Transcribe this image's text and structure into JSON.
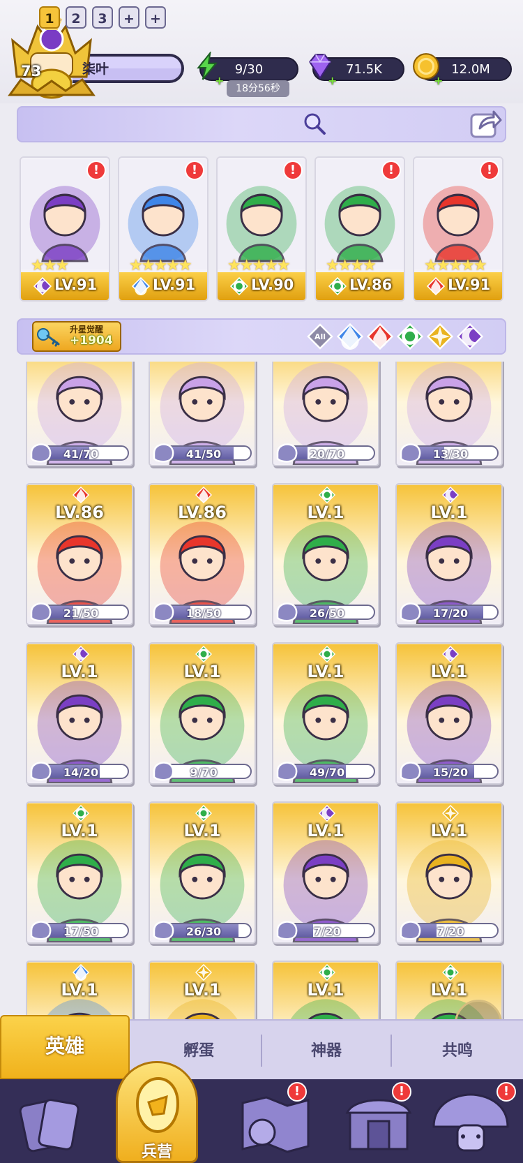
{
  "player": {
    "level": "73",
    "name": "柒叶"
  },
  "resources": {
    "energy": {
      "value": "9/30",
      "timer": "18分56秒",
      "icon": "lightning-icon"
    },
    "gems": {
      "value": "71.5K",
      "icon": "gem-icon"
    },
    "gold": {
      "value": "12.0M",
      "icon": "coin-icon"
    }
  },
  "team_tabs": [
    "1",
    "2",
    "3",
    "+",
    "+"
  ],
  "lineup": [
    {
      "level": "LV.91",
      "element": "dark",
      "stars": 3,
      "alert": "!"
    },
    {
      "level": "LV.91",
      "element": "water",
      "stars": 5,
      "alert": "!"
    },
    {
      "level": "LV.90",
      "element": "wind",
      "stars": 5,
      "alert": "!"
    },
    {
      "level": "LV.86",
      "element": "wind",
      "stars": 4,
      "alert": "!"
    },
    {
      "level": "LV.91",
      "element": "fire",
      "stars": 5,
      "alert": "!"
    }
  ],
  "awaken": {
    "label": "升星觉醒",
    "count": "+1904"
  },
  "filters": [
    {
      "label": "All",
      "icon": "all-filter-icon"
    },
    {
      "label": "",
      "icon": "water-element-icon"
    },
    {
      "label": "",
      "icon": "fire-element-icon"
    },
    {
      "label": "",
      "icon": "wind-element-icon"
    },
    {
      "label": "",
      "icon": "light-element-icon"
    },
    {
      "label": "",
      "icon": "dark-element-icon"
    }
  ],
  "heroes": [
    {
      "level": "",
      "element": "",
      "fragments": "41/70",
      "progress": 0.59
    },
    {
      "level": "",
      "element": "",
      "fragments": "41/50",
      "progress": 0.82
    },
    {
      "level": "",
      "element": "",
      "fragments": "20/70",
      "progress": 0.29
    },
    {
      "level": "",
      "element": "",
      "fragments": "13/30",
      "progress": 0.43
    },
    {
      "level": "LV.86",
      "element": "fire",
      "fragments": "21/50",
      "progress": 0.42
    },
    {
      "level": "LV.86",
      "element": "fire",
      "fragments": "18/50",
      "progress": 0.36
    },
    {
      "level": "LV.1",
      "element": "wind",
      "fragments": "26/50",
      "progress": 0.52
    },
    {
      "level": "LV.1",
      "element": "dark",
      "fragments": "17/20",
      "progress": 0.85
    },
    {
      "level": "LV.1",
      "element": "dark",
      "fragments": "14/20",
      "progress": 0.7
    },
    {
      "level": "LV.1",
      "element": "wind",
      "fragments": "9/70",
      "progress": 0.13
    },
    {
      "level": "LV.1",
      "element": "wind",
      "fragments": "49/70",
      "progress": 0.7
    },
    {
      "level": "LV.1",
      "element": "dark",
      "fragments": "15/20",
      "progress": 0.75
    },
    {
      "level": "LV.1",
      "element": "wind",
      "fragments": "17/50",
      "progress": 0.34
    },
    {
      "level": "LV.1",
      "element": "wind",
      "fragments": "26/30",
      "progress": 0.87
    },
    {
      "level": "LV.1",
      "element": "dark",
      "fragments": "7/20",
      "progress": 0.35
    },
    {
      "level": "LV.1",
      "element": "light",
      "fragments": "7/20",
      "progress": 0.35
    },
    {
      "level": "LV.1",
      "element": "water",
      "fragments": "",
      "progress": 0
    },
    {
      "level": "LV.1",
      "element": "light",
      "fragments": "",
      "progress": 0
    },
    {
      "level": "LV.1",
      "element": "wind",
      "fragments": "",
      "progress": 0
    },
    {
      "level": "LV.1",
      "element": "wind",
      "fragments": "",
      "progress": 0
    }
  ],
  "sub_tabs": [
    "英雄",
    "孵蛋",
    "神器",
    "共鸣"
  ],
  "nav": [
    {
      "label": "",
      "icon": "cards-icon",
      "alert": ""
    },
    {
      "label": "兵营",
      "icon": "barracks-icon",
      "alert": ""
    },
    {
      "label": "",
      "icon": "map-icon",
      "alert": "!"
    },
    {
      "label": "",
      "icon": "shrine-icon",
      "alert": "!"
    },
    {
      "label": "",
      "icon": "mushroom-icon",
      "alert": "!"
    }
  ],
  "colors": {
    "water": "#3f86e8",
    "fire": "#e8362c",
    "wind": "#2fae4a",
    "light": "#e9b320",
    "dark": "#7b3fc4",
    "accent_gold": "#f5c334",
    "panel_purple": "#cdc6f4",
    "nav_dark": "#342e57"
  }
}
